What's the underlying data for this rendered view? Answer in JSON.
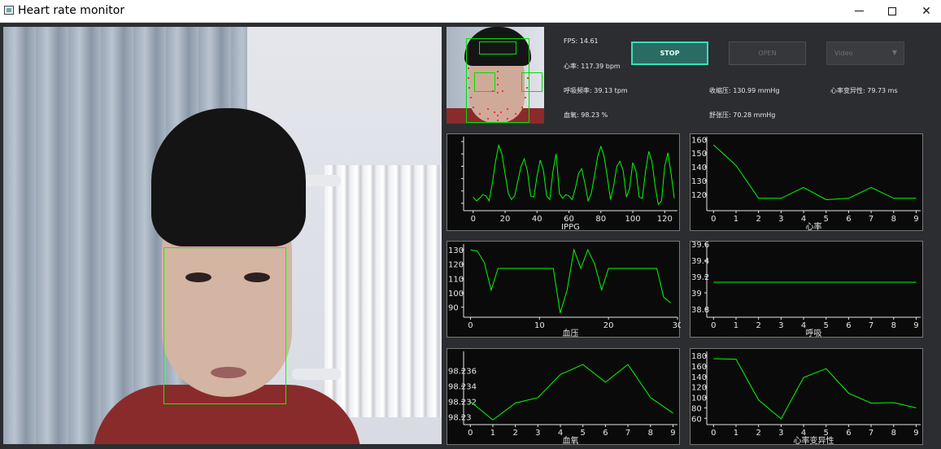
{
  "window": {
    "title": "Heart rate monitor",
    "minimize": "",
    "maximize": "",
    "close": "✕"
  },
  "readouts": {
    "fps": "FPS: 14.61",
    "heart_rate": "心率: 117.39 bpm",
    "resp_rate": "呼吸频率: 39.13 tpm",
    "systolic": "收缩压: 130.99 mmHg",
    "hrv": "心率变异性: 79.73 ms",
    "spo2": "血氧: 98.23 %",
    "diastolic": "舒张压: 70.28 mmHg"
  },
  "controls": {
    "stop_label": "STOP",
    "open_label": "OPEN",
    "source_value": "Video",
    "source_arrow": "▼"
  },
  "colors": {
    "plot_line": "#00ff00",
    "plot_bg": "#0a0a0a",
    "axis": "#e6e6e6",
    "accent": "#34e0b6"
  },
  "chart_data": [
    {
      "type": "line",
      "xlabel": "IPPG",
      "ylabel": "",
      "xlim": [
        -6,
        128
      ],
      "ylim": [
        -1.3,
        1.7
      ],
      "xticks": [
        0,
        20,
        40,
        60,
        80,
        100,
        120
      ],
      "yticks": [
        -1,
        -0.5,
        0,
        0.5,
        1,
        1.5
      ],
      "ytick_labels": [
        "",
        "",
        "",
        "",
        "",
        ""
      ],
      "series": [
        {
          "x": [
            0,
            2,
            4,
            6,
            8,
            10,
            12,
            14,
            16,
            18,
            20,
            22,
            24,
            26,
            28,
            30,
            32,
            34,
            36,
            38,
            40,
            42,
            44,
            46,
            48,
            50,
            52,
            54,
            56,
            58,
            60,
            62,
            64,
            66,
            68,
            70,
            72,
            74,
            76,
            78,
            80,
            82,
            84,
            86,
            88,
            90,
            92,
            94,
            96,
            98,
            100,
            102,
            104,
            106,
            108,
            110,
            112,
            114,
            116,
            118,
            120,
            122,
            124,
            126
          ],
          "y": [
            -0.75,
            -0.9,
            -0.8,
            -0.65,
            -0.7,
            -0.9,
            -0.2,
            0.7,
            1.35,
            1.0,
            0.2,
            -0.6,
            -0.85,
            -0.7,
            -0.1,
            0.5,
            0.8,
            0.3,
            -0.7,
            -0.75,
            0.1,
            0.75,
            0.35,
            -0.7,
            -0.85,
            0.3,
            1.0,
            -0.6,
            -0.8,
            -0.65,
            -0.7,
            -0.85,
            -0.4,
            0.2,
            0.4,
            -0.2,
            -0.9,
            -0.6,
            0.1,
            0.9,
            1.3,
            0.9,
            0.1,
            -0.85,
            -0.3,
            0.5,
            0.7,
            0.3,
            -0.75,
            -0.4,
            0.65,
            0.3,
            -0.75,
            -0.8,
            0.3,
            1.1,
            0.7,
            -0.3,
            -1.05,
            -0.9,
            0.5,
            1.05,
            0.2,
            -0.8
          ]
        }
      ]
    },
    {
      "type": "line",
      "xlabel": "心率",
      "ylabel": "",
      "xlim": [
        -0.3,
        9.2
      ],
      "ylim": [
        108,
        162
      ],
      "xticks": [
        0,
        1,
        2,
        3,
        4,
        5,
        6,
        7,
        8,
        9
      ],
      "yticks": [
        120,
        130,
        140,
        150,
        160
      ],
      "ytick_labels": [
        "120",
        "130",
        "140",
        "150",
        "160"
      ],
      "series": [
        {
          "x": [
            0,
            1,
            2,
            3,
            4,
            5,
            6,
            7,
            8,
            9
          ],
          "y": [
            156,
            141,
            117,
            117,
            125,
            116,
            117,
            125,
            117,
            117
          ]
        }
      ]
    },
    {
      "type": "line",
      "xlabel": "血压",
      "ylabel": "",
      "xlim": [
        -1,
        30
      ],
      "ylim": [
        83,
        134
      ],
      "xticks": [
        0,
        10,
        20,
        30
      ],
      "yticks": [
        90,
        100,
        110,
        120,
        130
      ],
      "ytick_labels": [
        "90",
        "100",
        "110",
        "120",
        "130"
      ],
      "series": [
        {
          "x": [
            0,
            1,
            2,
            3,
            4,
            5,
            6,
            7,
            8,
            9,
            10,
            11,
            12,
            13,
            14,
            15,
            16,
            17,
            18,
            19,
            20,
            21,
            22,
            23,
            24,
            25,
            26,
            27,
            28,
            29
          ],
          "y": [
            130,
            129,
            121,
            102,
            117,
            117,
            117,
            117,
            117,
            117,
            117,
            117,
            117,
            86,
            102,
            130,
            117,
            130,
            120,
            102,
            117,
            117,
            117,
            117,
            117,
            117,
            117,
            117,
            97,
            93
          ]
        }
      ]
    },
    {
      "type": "line",
      "xlabel": "呼吸",
      "ylabel": "",
      "xlim": [
        -0.3,
        9.2
      ],
      "ylim": [
        38.7,
        39.6
      ],
      "xticks": [
        0,
        1,
        2,
        3,
        4,
        5,
        6,
        7,
        8,
        9
      ],
      "yticks": [
        38.8,
        39,
        39.2,
        39.4,
        39.6
      ],
      "ytick_labels": [
        "38.8",
        "39",
        "39.2",
        "39.4",
        "39.6"
      ],
      "series": [
        {
          "x": [
            0,
            1,
            2,
            3,
            4,
            5,
            6,
            7,
            8,
            9
          ],
          "y": [
            39.13,
            39.13,
            39.13,
            39.13,
            39.13,
            39.13,
            39.13,
            39.13,
            39.13,
            39.13
          ]
        }
      ]
    },
    {
      "type": "line",
      "xlabel": "血氧",
      "ylabel": "",
      "xlim": [
        -0.3,
        9.2
      ],
      "ylim": [
        98.229,
        98.2385
      ],
      "xticks": [
        0,
        1,
        2,
        3,
        4,
        5,
        6,
        7,
        8,
        9
      ],
      "yticks": [
        98.23,
        98.232,
        98.234,
        98.236
      ],
      "ytick_labels": [
        "98.23",
        "98.232",
        "98.234",
        "98.236"
      ],
      "series": [
        {
          "x": [
            0,
            1,
            2,
            3,
            4,
            5,
            6,
            7,
            8,
            9
          ],
          "y": [
            98.232,
            98.2296,
            98.2318,
            98.2325,
            98.2355,
            98.2368,
            98.2345,
            98.2368,
            98.2325,
            98.2305
          ]
        }
      ]
    },
    {
      "type": "line",
      "xlabel": "心率变异性",
      "ylabel": "",
      "xlim": [
        -0.3,
        9.2
      ],
      "ylim": [
        48,
        188
      ],
      "xticks": [
        0,
        1,
        2,
        3,
        4,
        5,
        6,
        7,
        8,
        9
      ],
      "yticks": [
        60,
        80,
        100,
        120,
        140,
        160,
        180
      ],
      "ytick_labels": [
        "60",
        "80",
        "100",
        "120",
        "140",
        "160",
        "180"
      ],
      "series": [
        {
          "x": [
            0,
            1,
            2,
            3,
            4,
            5,
            6,
            7,
            8,
            9
          ],
          "y": [
            174,
            173,
            95,
            59,
            138,
            155,
            108,
            89,
            90,
            80
          ]
        }
      ]
    }
  ]
}
